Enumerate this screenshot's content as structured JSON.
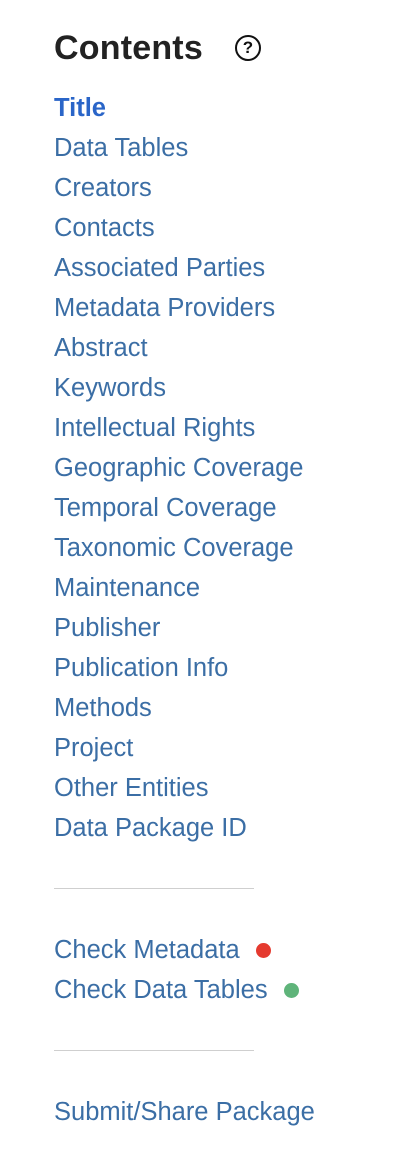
{
  "header": {
    "title": "Contents",
    "help_icon": "question-circle-icon",
    "help_glyph": "?"
  },
  "nav": {
    "items": [
      {
        "label": "Title",
        "active": true
      },
      {
        "label": "Data Tables"
      },
      {
        "label": "Creators"
      },
      {
        "label": "Contacts"
      },
      {
        "label": "Associated Parties"
      },
      {
        "label": "Metadata Providers"
      },
      {
        "label": "Abstract"
      },
      {
        "label": "Keywords"
      },
      {
        "label": "Intellectual Rights"
      },
      {
        "label": "Geographic Coverage"
      },
      {
        "label": "Temporal Coverage"
      },
      {
        "label": "Taxonomic Coverage"
      },
      {
        "label": "Maintenance"
      },
      {
        "label": "Publisher"
      },
      {
        "label": "Publication Info"
      },
      {
        "label": "Methods"
      },
      {
        "label": "Project"
      },
      {
        "label": "Other Entities"
      },
      {
        "label": "Data Package ID"
      }
    ]
  },
  "checks": {
    "items": [
      {
        "label": "Check Metadata",
        "status": "error",
        "status_color": "#e53a2f"
      },
      {
        "label": "Check Data Tables",
        "status": "ok",
        "status_color": "#5fb47a"
      }
    ]
  },
  "submit": {
    "label": "Submit/Share Package"
  },
  "colors": {
    "link": "#3b6ea5",
    "active_link": "#2a65c8",
    "title": "#222222",
    "divider": "#cfcfcf"
  }
}
